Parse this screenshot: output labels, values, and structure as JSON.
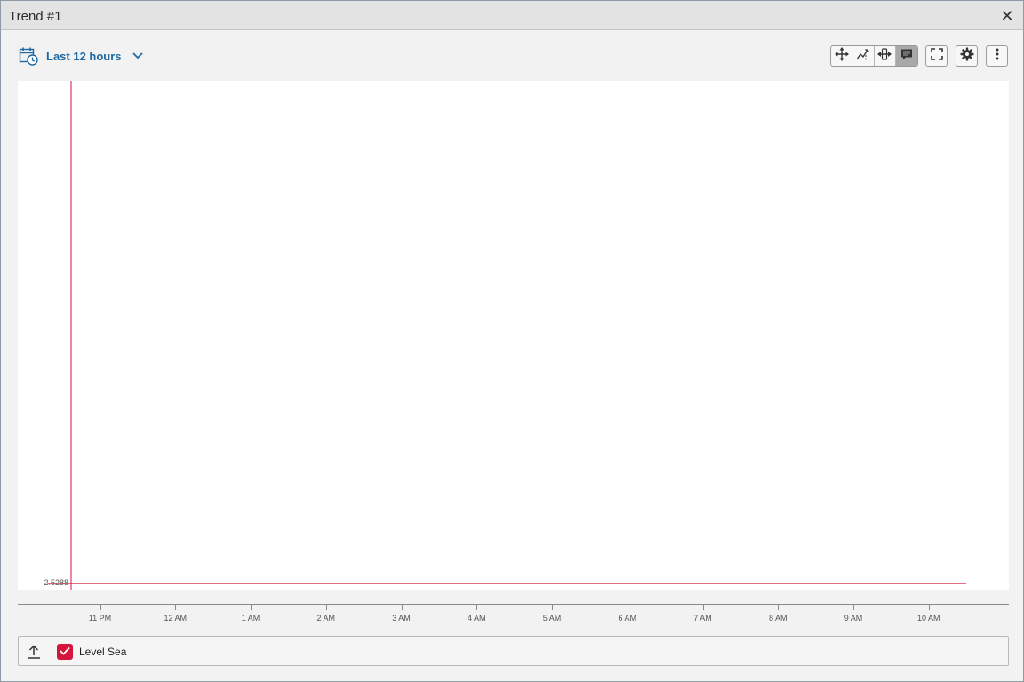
{
  "window": {
    "title": "Trend #1",
    "close_icon": "close-icon"
  },
  "toolbar": {
    "range_label": "Last 12 hours",
    "range_icon": "calendar-clock-icon",
    "tools": [
      {
        "name": "pan",
        "icon": "pan-arrows-icon",
        "active": false
      },
      {
        "name": "zoom-select",
        "icon": "zoom-select-icon",
        "active": false
      },
      {
        "name": "zoom-horizontal",
        "icon": "horizontal-zoom-icon",
        "active": false
      },
      {
        "name": "comment",
        "icon": "comment-icon",
        "active": true
      }
    ],
    "fullscreen_icon": "fullscreen-icon",
    "settings_icon": "gear-icon",
    "more_icon": "more-vertical-icon"
  },
  "chart_data": {
    "type": "line",
    "title": "",
    "xlabel": "",
    "ylabel": "",
    "x_tick_labels": [
      "11 PM",
      "12 AM",
      "1 AM",
      "2 AM",
      "3 AM",
      "4 AM",
      "5 AM",
      "6 AM",
      "7 AM",
      "8 AM",
      "9 AM",
      "10 AM"
    ],
    "y_tick_labels": [
      "2.5288"
    ],
    "series": [
      {
        "name": "Level Sea",
        "color": "#d4163c",
        "x_hours_after_10pm": [
          0.3,
          12.5
        ],
        "values": [
          2.5288,
          2.5288
        ]
      }
    ],
    "grid": false
  },
  "legend": {
    "collapse_icon": "upload-arrow-icon",
    "items": [
      {
        "label": "Level Sea",
        "checked": true,
        "color": "#d4163c"
      }
    ]
  }
}
